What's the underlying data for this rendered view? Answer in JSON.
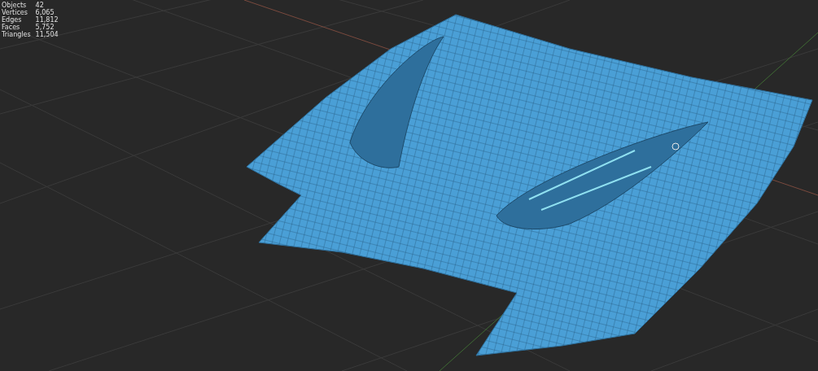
{
  "stats": [
    {
      "label": "Objects",
      "value": "42"
    },
    {
      "label": "Vertices",
      "value": "6,065"
    },
    {
      "label": "Edges",
      "value": "11,812"
    },
    {
      "label": "Faces",
      "value": "5,752"
    },
    {
      "label": "Triangles",
      "value": "11,504"
    }
  ]
}
